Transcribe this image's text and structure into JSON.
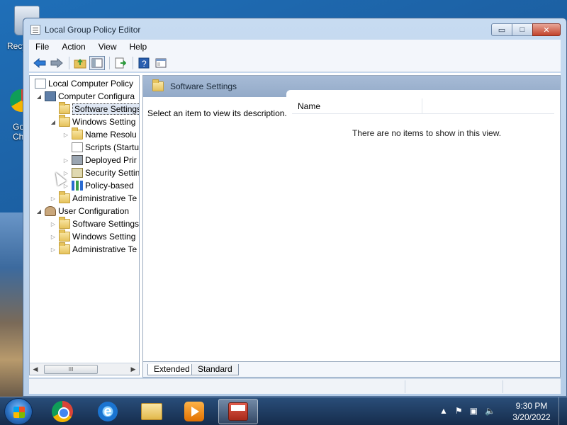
{
  "desktop": {
    "recycle_label": "Recy",
    "chrome_label_1": "Go",
    "chrome_label_2": "Ch"
  },
  "window": {
    "title": "Local Group Policy Editor",
    "buttons": {
      "minimize": "▭",
      "maximize": "□",
      "close": "✕"
    }
  },
  "menu": [
    "File",
    "Action",
    "View",
    "Help"
  ],
  "toolbar": {
    "icons": [
      "back-arrow-icon",
      "forward-arrow-icon",
      "up-folder-icon",
      "show-hide-tree-icon",
      "export-list-icon",
      "help-icon",
      "properties-icon"
    ]
  },
  "tree": {
    "root": "Local Computer Policy",
    "computer_config": "Computer Configura",
    "cc_software": "Software Settings",
    "cc_windows": "Windows Setting",
    "name_resolution": "Name Resolu",
    "scripts": "Scripts (Startu",
    "deployed_printers": "Deployed Prir",
    "security_settings": "Security Settin",
    "policy_based": "Policy-based",
    "cc_admin": "Administrative Te",
    "user_config": "User Configuration",
    "uc_software": "Software Settings",
    "uc_windows": "Windows Setting",
    "uc_admin": "Administrative Te",
    "scroll_thumb": "III"
  },
  "pane": {
    "header": "Software Settings",
    "description": "Select an item to view its description.",
    "column_name": "Name",
    "empty_text": "There are no items to show in this view.",
    "tabs": [
      "Extended",
      "Standard"
    ]
  },
  "taskbar": {
    "apps": [
      "chrome",
      "internet-explorer",
      "windows-explorer",
      "media-player",
      "group-policy-editor"
    ],
    "time": "9:30 PM",
    "date": "3/20/2022"
  }
}
